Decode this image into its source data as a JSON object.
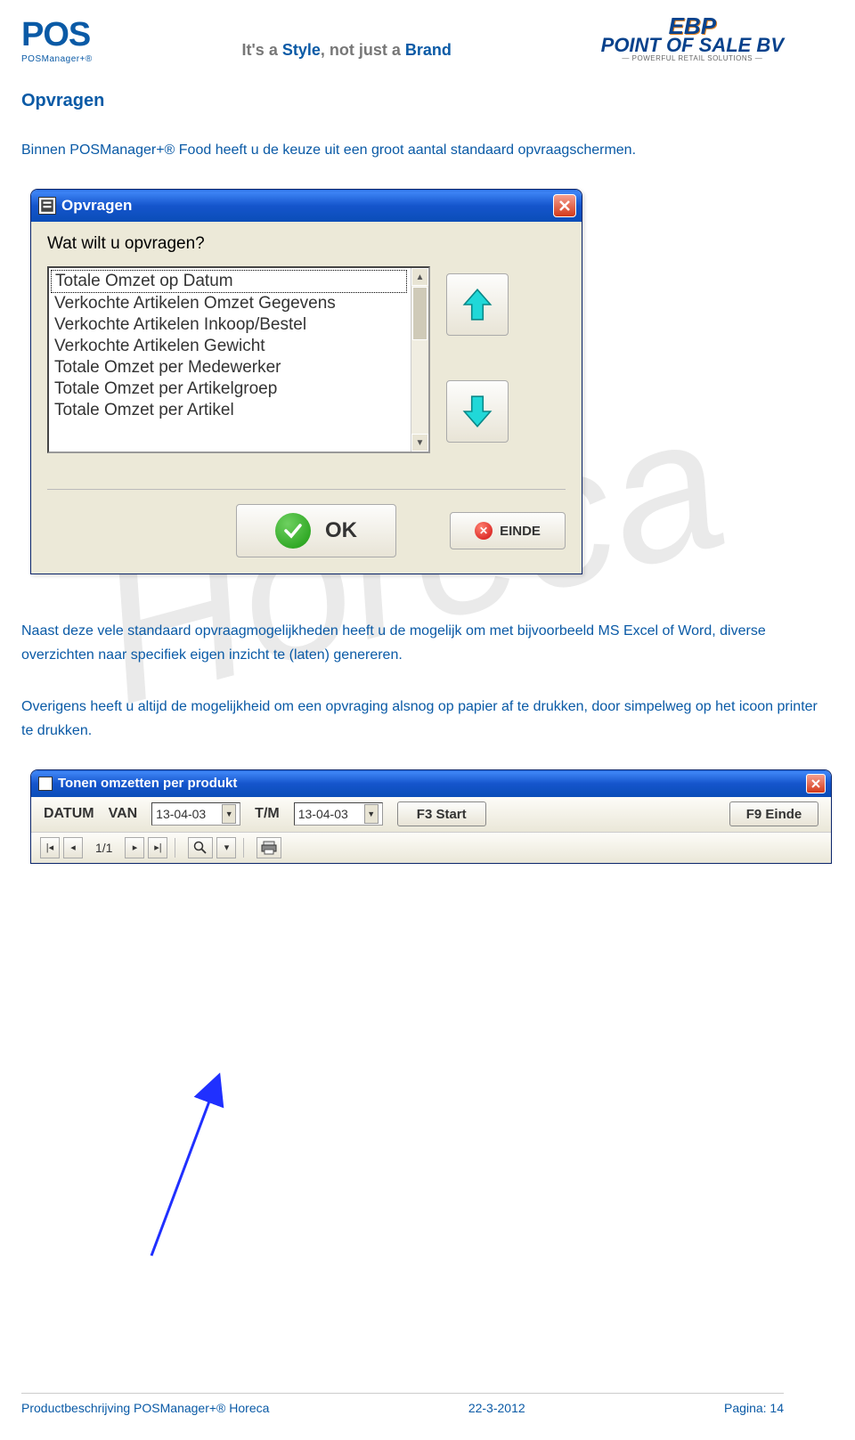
{
  "header": {
    "logo_left_main": "POS",
    "logo_left_sub": "POSManager+®",
    "tagline_prefix": "It's a ",
    "tagline_style": "Style",
    "tagline_mid": ", not just a ",
    "tagline_brand": "Brand",
    "logo_right_line1": "EBP",
    "logo_right_line2": "POINT OF SALE BV",
    "logo_right_sub": "— POWERFUL RETAIL SOLUTIONS —"
  },
  "content": {
    "section_title": "Opvragen",
    "para1": "Binnen POSManager+® Food heeft u de keuze uit een groot aantal standaard opvraagschermen.",
    "para2": "Naast deze vele standaard opvraagmogelijkheden heeft u de mogelijk om met bijvoorbeeld MS Excel of Word, diverse overzichten naar specifiek eigen inzicht te (laten) genereren.",
    "para3": "Overigens heeft u altijd de mogelijkheid om een opvraging alsnog op papier af te drukken, door simpelweg op het icoon printer te drukken."
  },
  "dialog1": {
    "title": "Opvragen",
    "prompt": "Wat wilt u opvragen?",
    "items": [
      "Totale Omzet op Datum",
      "Verkochte Artikelen Omzet Gegevens",
      "Verkochte Artikelen Inkoop/Bestel",
      "Verkochte Artikelen Gewicht",
      "Totale Omzet per Medewerker",
      "Totale Omzet per Artikelgroep",
      "Totale Omzet per Artikel"
    ],
    "selected_index": 0,
    "ok_label": "OK",
    "einde_label": "EINDE"
  },
  "window2": {
    "title": "Tonen omzetten per produkt",
    "datum_label": "DATUM",
    "van_label": "VAN",
    "van_value": "13-04-03",
    "tm_label": "T/M",
    "tm_value": "13-04-03",
    "f3_label": "F3 Start",
    "f9_label": "F9 Einde",
    "page_indicator": "1/1"
  },
  "footer": {
    "left": "Productbeschrijving POSManager+® Horeca",
    "center": "22-3-2012",
    "right": "Pagina: 14"
  }
}
